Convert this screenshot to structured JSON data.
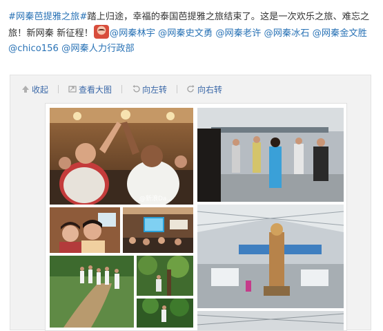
{
  "post": {
    "topic1": "#网秦芭提雅之旅#",
    "text1": "踏上归途，幸福的泰国芭提雅之旅结束了。这是一次欢乐之旅、难忘之旅！新网秦 新征程！",
    "mentions": [
      "@网秦林宇",
      "@网秦史文勇",
      "@网秦老许",
      "@网秦冰石",
      "@网秦金文胜",
      "@chico156",
      "@网秦人力行政部"
    ]
  },
  "toolbar": {
    "collapse": "收起",
    "view_large": "查看大图",
    "rotate_left": "向左转",
    "rotate_right": "向右转"
  },
  "images": {
    "watermark": "@新浪Da..."
  }
}
